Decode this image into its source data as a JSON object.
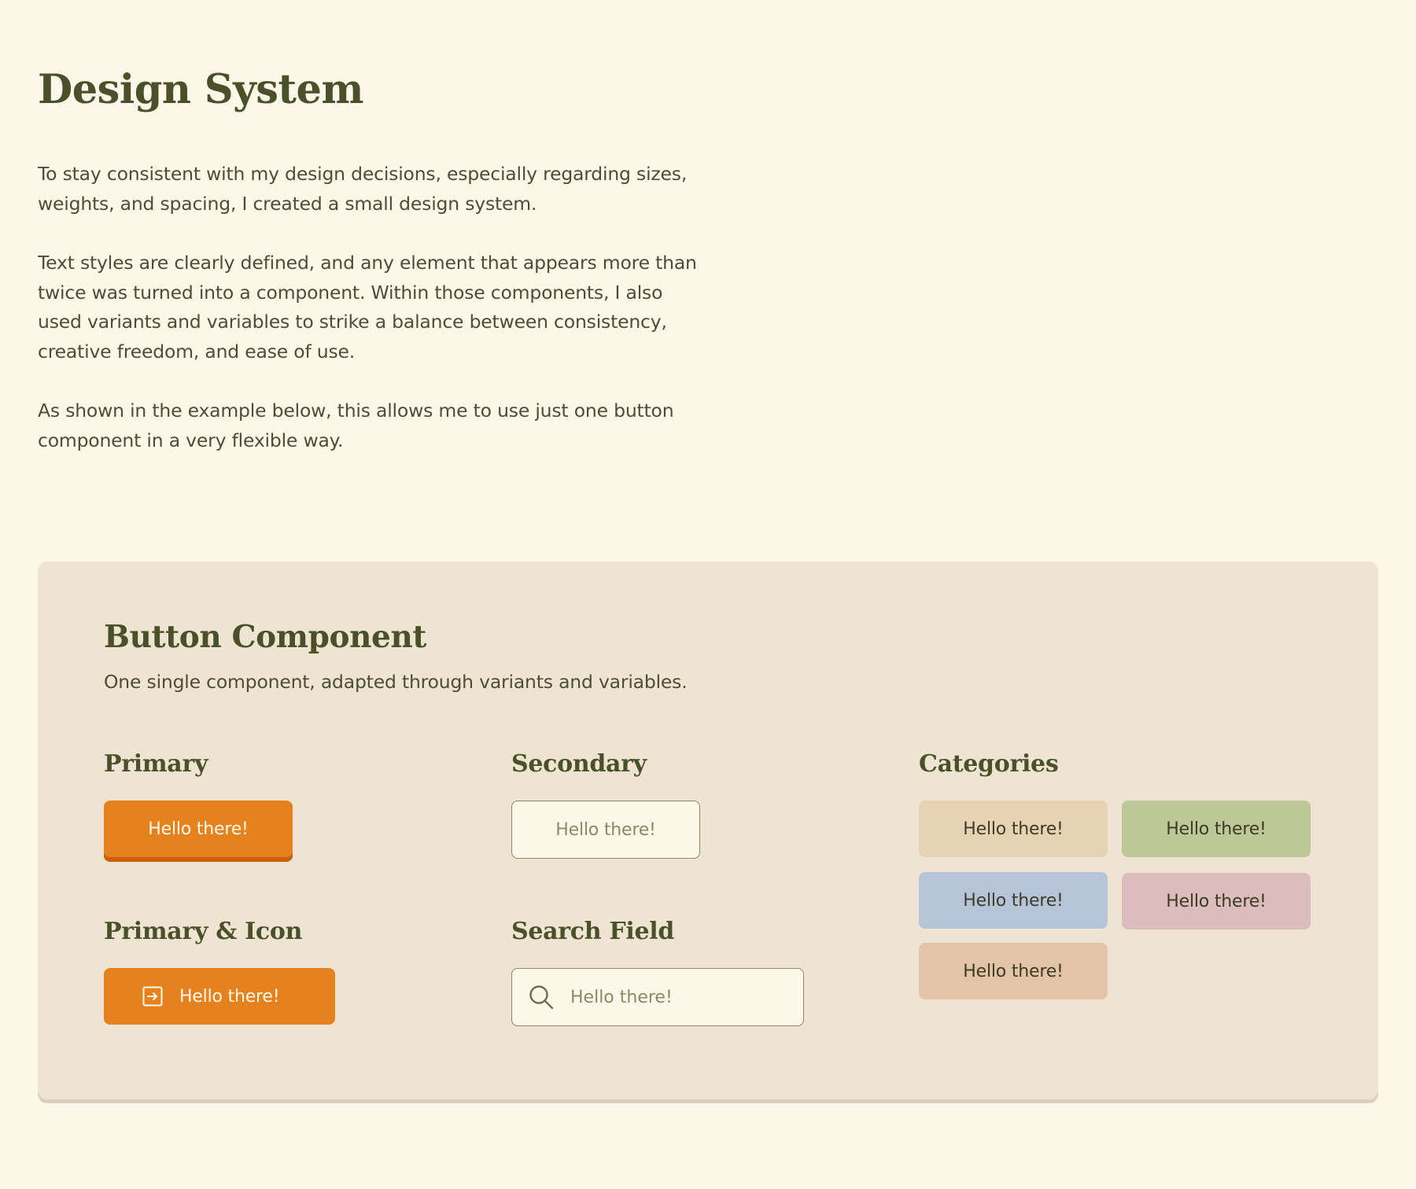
{
  "page": {
    "title": "Design System",
    "intro_paragraphs": [
      "To stay consistent with my design decisions, especially regarding sizes, weights, and spacing, I created a small design system.",
      "Text styles are clearly defined, and any element that appears more than twice was turned into a component. Within those components, I also used variants and variables to strike a balance between consistency, creative freedom, and ease of use.",
      "As shown in the example below, this allows me to use just one button component in a very flexible way."
    ]
  },
  "component_card": {
    "title": "Button Component",
    "subtitle": "One single component, adapted through variants and variables.",
    "primary": {
      "label": "Primary",
      "button_label": "Hello there!"
    },
    "primary_icon": {
      "label": "Primary & Icon",
      "button_label": "Hello there!",
      "icon": "arrow-into-box-icon"
    },
    "secondary": {
      "label": "Secondary",
      "button_label": "Hello there!"
    },
    "search_field": {
      "label": "Search Field",
      "placeholder": "Hello there!",
      "icon": "search-icon"
    },
    "categories": {
      "label": "Categories",
      "items": [
        {
          "label": "Hello there!",
          "color": "#e8d2b4"
        },
        {
          "label": "Hello there!",
          "color": "#bec797"
        },
        {
          "label": "Hello there!",
          "color": "#b6c4da"
        },
        {
          "label": "Hello there!",
          "color": "#dcbcbc"
        },
        {
          "label": "Hello there!",
          "color": "#e3c4a6"
        }
      ]
    }
  },
  "colors": {
    "background": "#fdf7ea",
    "card": "#efe4d2",
    "heading": "#4a5029",
    "body_text": "#4d4d33",
    "primary": "#e6821e",
    "primary_shadow": "#c8620e",
    "secondary_border": "#8b8a62"
  }
}
